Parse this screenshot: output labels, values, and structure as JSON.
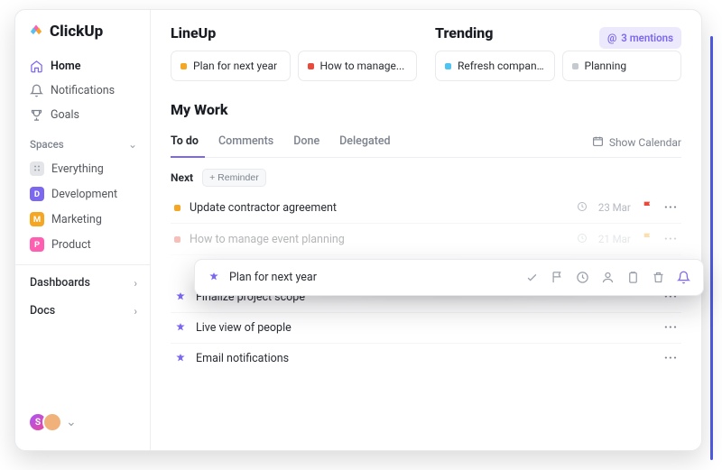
{
  "brand": "ClickUp",
  "sidebar": {
    "nav": [
      {
        "label": "Home",
        "icon": "home",
        "active": true
      },
      {
        "label": "Notifications",
        "icon": "bell",
        "active": false
      },
      {
        "label": "Goals",
        "icon": "trophy",
        "active": false
      }
    ],
    "spaces_header": "Spaces",
    "spaces": [
      {
        "label": "Everything",
        "badge": "∷",
        "badge_cls": "bd-grey"
      },
      {
        "label": "Development",
        "badge": "D",
        "badge_cls": "bd-purple"
      },
      {
        "label": "Marketing",
        "badge": "M",
        "badge_cls": "bd-amber"
      },
      {
        "label": "Product",
        "badge": "P",
        "badge_cls": "bd-pink"
      }
    ],
    "dashboards": "Dashboards",
    "docs": "Docs",
    "avatars": [
      {
        "initial": "S",
        "cls": "av1"
      },
      {
        "initial": "👤",
        "cls": "av2"
      }
    ]
  },
  "header": {
    "lineup": "LineUp",
    "trending": "Trending",
    "mentions": "3 mentions"
  },
  "lineup_cards": [
    {
      "label": "Plan for next year",
      "dot": "d-amber"
    },
    {
      "label": "How to manage...",
      "dot": "d-red"
    }
  ],
  "trending_cards": [
    {
      "label": "Refresh compan...",
      "dot": "d-sky"
    },
    {
      "label": "Planning",
      "dot": "d-grey"
    }
  ],
  "mywork": {
    "title": "My Work",
    "tabs": [
      {
        "label": "To do",
        "active": true
      },
      {
        "label": "Comments"
      },
      {
        "label": "Done"
      },
      {
        "label": "Delegated"
      }
    ],
    "show_calendar": "Show Calendar",
    "next_label": "Next",
    "reminder_btn": "+ Reminder",
    "tasks": [
      {
        "label": "Update contractor agreement",
        "dot": "d-amber",
        "date": "23 Mar",
        "flag": "red",
        "kind": "task"
      },
      {
        "label": "How to manage event planning",
        "dot": "d-red",
        "date": "21 Mar",
        "flag": "amber",
        "kind": "task",
        "dim": true
      },
      {
        "label": "Finalize project scope",
        "kind": "reminder"
      },
      {
        "label": "Live view of people",
        "kind": "reminder"
      },
      {
        "label": "Email notifications",
        "kind": "reminder"
      }
    ]
  },
  "popover": {
    "label": "Plan for next year",
    "actions": [
      "check",
      "flag",
      "clock",
      "user",
      "clipboard",
      "trash",
      "bell"
    ]
  }
}
